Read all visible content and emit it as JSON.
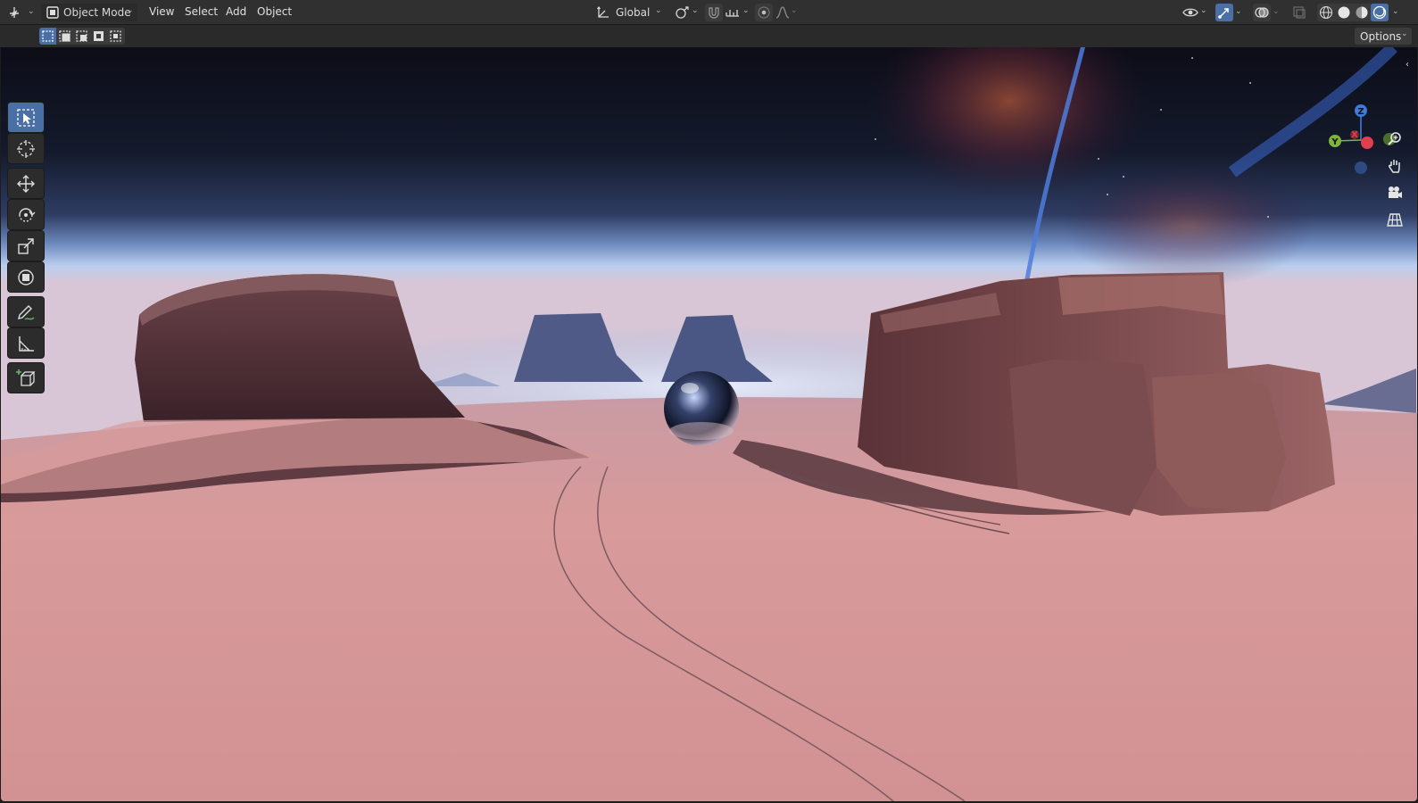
{
  "header": {
    "editor_type_icon": "3d-viewport-icon",
    "mode_select": {
      "value": "Object Mode",
      "icon": "object-mode-icon"
    },
    "menus": [
      "View",
      "Select",
      "Add",
      "Object"
    ],
    "transform_orientation": {
      "value": "Global",
      "icon": "orientation-axes-icon"
    },
    "pivot_icon": "pivot-point-icon",
    "snap_icon": "magnet-icon",
    "snap_target_icon": "snap-increment-icon",
    "proportional_icon": "proportional-editing-icon",
    "falloff_icon": "falloff-curve-icon",
    "visibility_icon": "eye-icon",
    "gizmo_toggle_icon": "gizmo-icon",
    "overlays_icon": "overlays-icon",
    "xray_icon": "xray-icon",
    "shading_modes": [
      "wireframe",
      "solid",
      "material-preview",
      "rendered"
    ],
    "active_shading": "rendered"
  },
  "subheader": {
    "select_modes": [
      "set",
      "extend",
      "subtract",
      "difference",
      "intersect"
    ],
    "options_label": "Options"
  },
  "toolbar": {
    "tools": [
      "select-box",
      "cursor",
      "move",
      "rotate",
      "scale",
      "transform",
      "annotate",
      "measure",
      "add-cube"
    ],
    "active_tool": "select-box"
  },
  "navigation": {
    "gizmo_axes": {
      "x": "X",
      "y": "Y",
      "z": "Z"
    },
    "axis_colors": {
      "x": "#e0404d",
      "y": "#7cb53a",
      "z": "#3f7bd8"
    },
    "buttons": [
      "zoom",
      "pan",
      "camera",
      "ortho"
    ]
  },
  "colors": {
    "header_bg": "#303030",
    "accent": "#4a6fa5",
    "sand": "#d89a9a",
    "sky_top": "#0e0f1d",
    "haze": "#9db7dd"
  }
}
